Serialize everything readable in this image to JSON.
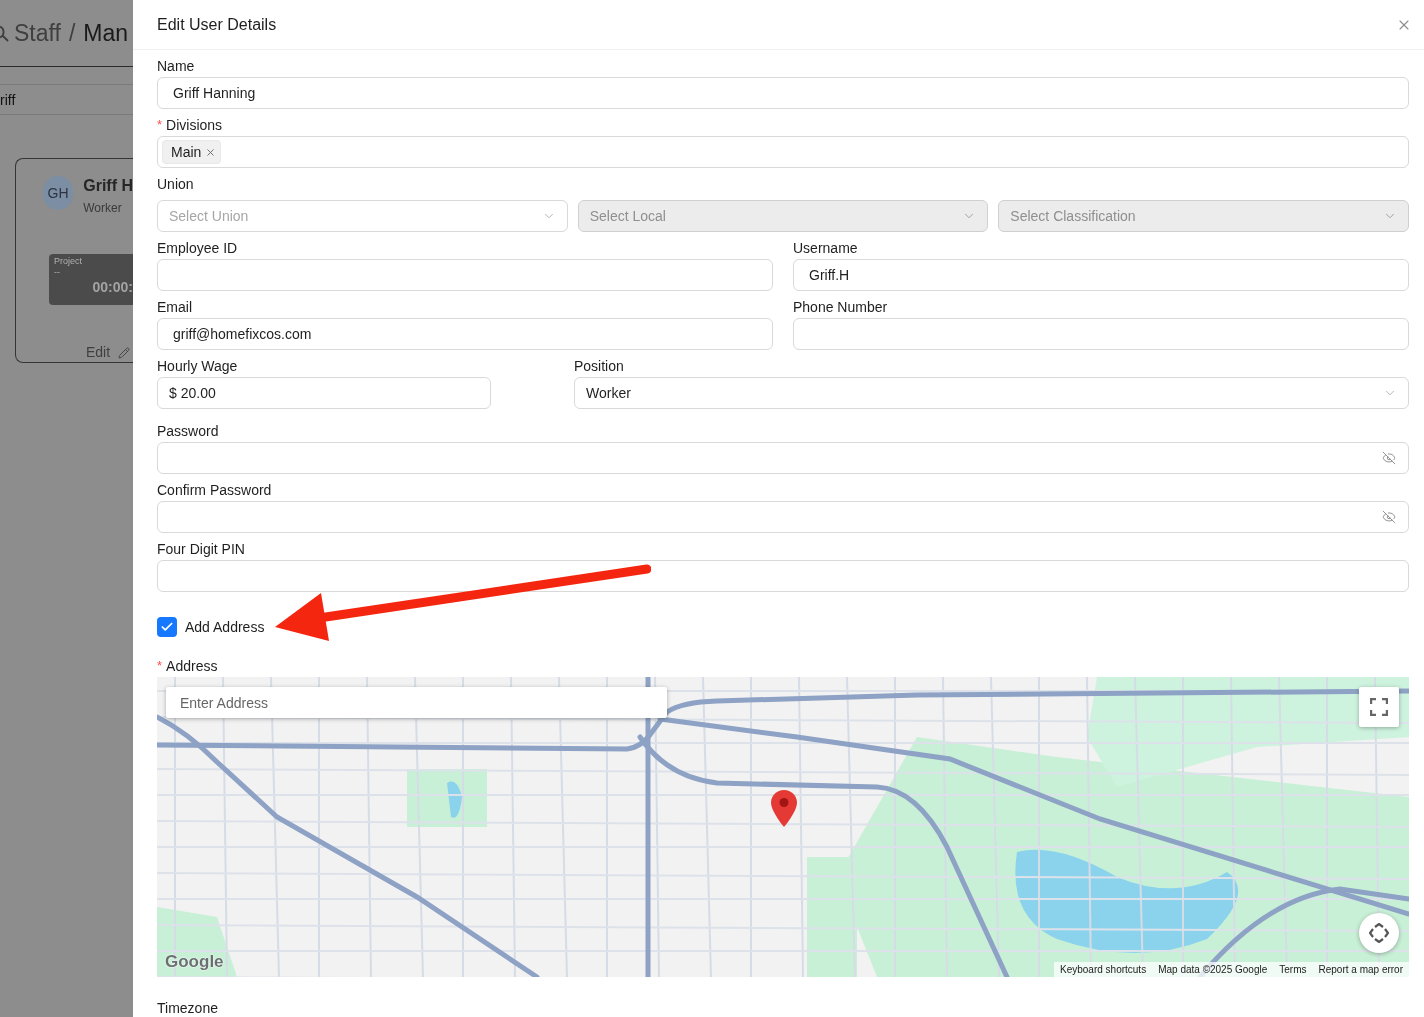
{
  "background_page": {
    "breadcrumb": {
      "items": [
        "Staff",
        "Man"
      ],
      "separator": "/"
    },
    "search": {
      "value": "riff"
    },
    "card": {
      "avatar": "GH",
      "name": "Griff H",
      "role": "Worker",
      "project": {
        "label": "Project",
        "value": "--",
        "timer": "00:00:"
      },
      "edit_link": "Edit"
    }
  },
  "dialog": {
    "title": "Edit User Details",
    "rows": [
      {
        "fields": [
          {
            "kind": "text",
            "label": "Name",
            "value": "Griff Hanning"
          }
        ]
      },
      {
        "fields": [
          {
            "kind": "tags",
            "label": "Divisions",
            "required_mark": "*",
            "tags": [
              "Main"
            ]
          }
        ]
      },
      {
        "fields": [
          {
            "kind": "select_group",
            "label": "Union",
            "selects": [
              {
                "placeholder": "Select Union",
                "disabled": false
              },
              {
                "placeholder": "Select Local",
                "disabled": true
              },
              {
                "placeholder": "Select Classification",
                "disabled": true
              }
            ]
          }
        ]
      },
      {
        "fields": [
          {
            "kind": "text",
            "label": "Employee ID"
          },
          {
            "kind": "text",
            "label": "Username",
            "value": "Griff.H"
          }
        ]
      },
      {
        "fields": [
          {
            "kind": "text",
            "label": "Email",
            "value": "griff@homefixcos.com"
          },
          {
            "kind": "text",
            "label": "Phone Number"
          }
        ]
      },
      {
        "fields": [
          {
            "kind": "currency",
            "label": "Hourly Wage",
            "prefix": "$",
            "value": "20.00"
          },
          {
            "kind": "select",
            "label": "Position",
            "value": "Worker"
          }
        ]
      },
      {
        "fields": [
          {
            "kind": "password",
            "label": "Password"
          }
        ]
      },
      {
        "fields": [
          {
            "kind": "password",
            "label": "Confirm Password"
          }
        ]
      },
      {
        "fields": [
          {
            "kind": "text",
            "label": "Four Digit PIN"
          }
        ]
      },
      {
        "fields": [
          {
            "kind": "checkbox",
            "label": "Add Address",
            "checked": true
          }
        ]
      },
      {
        "fields": [
          {
            "kind": "map",
            "label": "Address",
            "required_mark": "*",
            "search_placeholder": "Enter Address",
            "logo": "Google",
            "attribution": [
              "Keyboard shortcuts",
              "Map data ©2025 Google",
              "Terms",
              "Report a map error"
            ]
          }
        ]
      },
      {
        "fields": [
          {
            "kind": "label",
            "label": "Timezone"
          }
        ]
      }
    ]
  }
}
